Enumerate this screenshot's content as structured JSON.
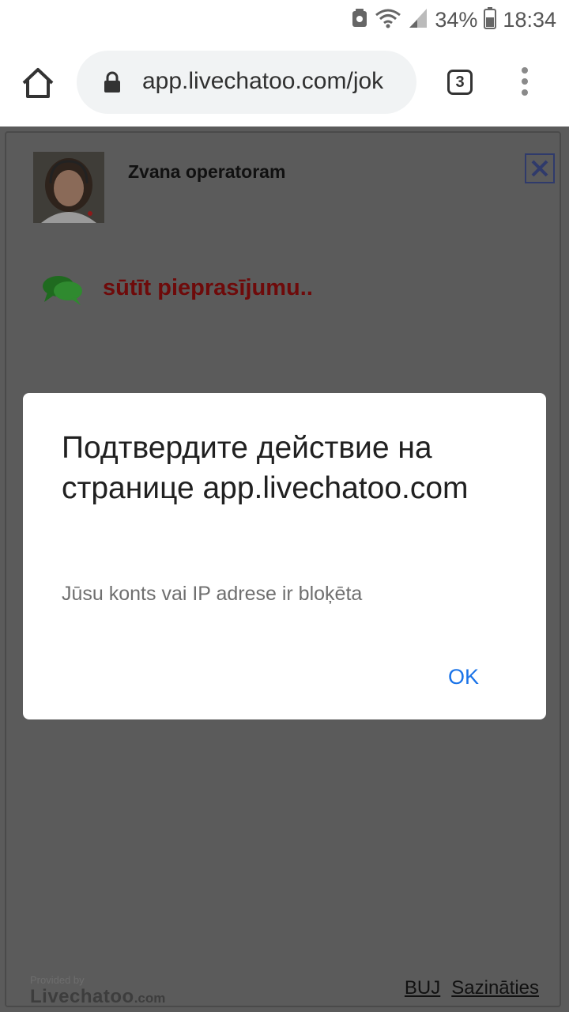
{
  "status_bar": {
    "battery": "34%",
    "time": "18:34"
  },
  "browser": {
    "url": "app.livechatoo.com/jok",
    "tab_count": "3"
  },
  "widget": {
    "title": "Zvana operatoram",
    "request_link": "sūtīt pieprasījumu..",
    "provided_by": "Provided by",
    "brand": "Livechatoo",
    "brand_suffix": ".com",
    "footer_links": [
      "BUJ",
      "Sazināties"
    ]
  },
  "dialog": {
    "title": "Подтвердите действие на странице app.livechatoo.com",
    "message": "Jūsu konts vai IP adrese ir bloķēta",
    "ok_label": "OK"
  }
}
